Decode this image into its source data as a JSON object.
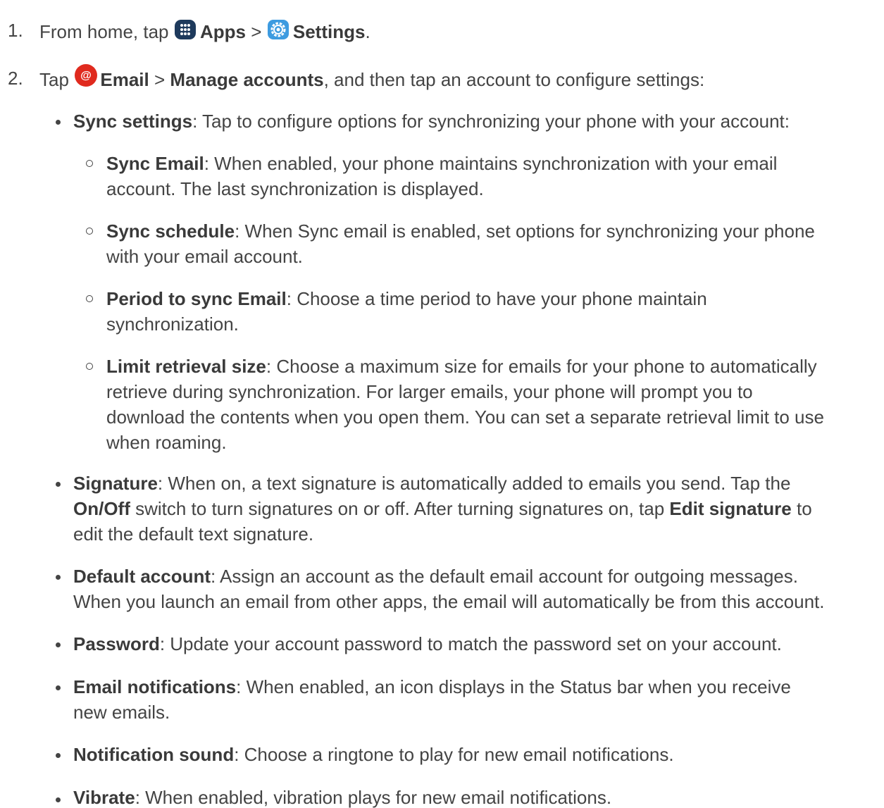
{
  "step1": {
    "num": "1.",
    "pre": "From home, tap",
    "apps": "Apps",
    "sep": ">",
    "settings": "Settings",
    "end": "."
  },
  "step2": {
    "num": "2.",
    "pre": "Tap",
    "email": "Email",
    "sep": ">",
    "manage": "Manage accounts",
    "post": ", and then tap an account to configure settings:"
  },
  "sync": {
    "title": "Sync settings",
    "text": ": Tap to configure options for synchronizing your phone with your account:"
  },
  "sync_email": {
    "title": "Sync Email",
    "l1": ": When enabled, your phone maintains synchronization with your email",
    "l2": "account. The last synchronization is displayed."
  },
  "sync_schedule": {
    "title": "Sync schedule",
    "l1": ": When Sync email is enabled, set options for synchronizing your phone",
    "l2": "with your email account."
  },
  "period": {
    "title": "Period to sync Email",
    "l1": ": Choose a time period to have your phone maintain",
    "l2": "synchronization."
  },
  "limit": {
    "title": "Limit retrieval size",
    "l1": ": Choose a maximum size for emails for your phone to automatically",
    "l2": "retrieve during synchronization. For larger emails, your phone will prompt you to",
    "l3": "download the contents when you open them. You can set a separate retrieval limit to use",
    "l4": "when roaming."
  },
  "signature": {
    "title": "Signature",
    "l1": ": When on, a text signature is automatically added to emails you send. Tap the",
    "onoff": "On/Off",
    "l2": " switch to turn signatures on or off. After turning signatures on, tap ",
    "edit": "Edit signature",
    "l2b": " to",
    "l3": "edit the default text signature."
  },
  "default_account": {
    "title": "Default account",
    "l1": ": Assign an account as the default email account for outgoing messages.",
    "l2": "When you launch an email from other apps, the email will automatically be from this account."
  },
  "password": {
    "title": "Password",
    "l1": ": Update your account password to match the password set on your account."
  },
  "email_notifications": {
    "title": "Email notifications",
    "l1": ": When enabled, an icon displays in the Status bar when you receive",
    "l2": "new emails."
  },
  "notification_sound": {
    "title": "Notification sound",
    "l1": ": Choose a ringtone to play for new email notifications."
  },
  "vibrate": {
    "title": "Vibrate",
    "l1": ": When enabled, vibration plays for new email notifications."
  },
  "icons": {
    "apps": "apps-grid-icon",
    "settings": "settings-gear-icon",
    "email": "email-at-icon"
  },
  "colors": {
    "text": "#444444",
    "apps_icon": "#1e3a5c",
    "settings_icon": "#3d9be0",
    "email_icon": "#e02a1e"
  }
}
